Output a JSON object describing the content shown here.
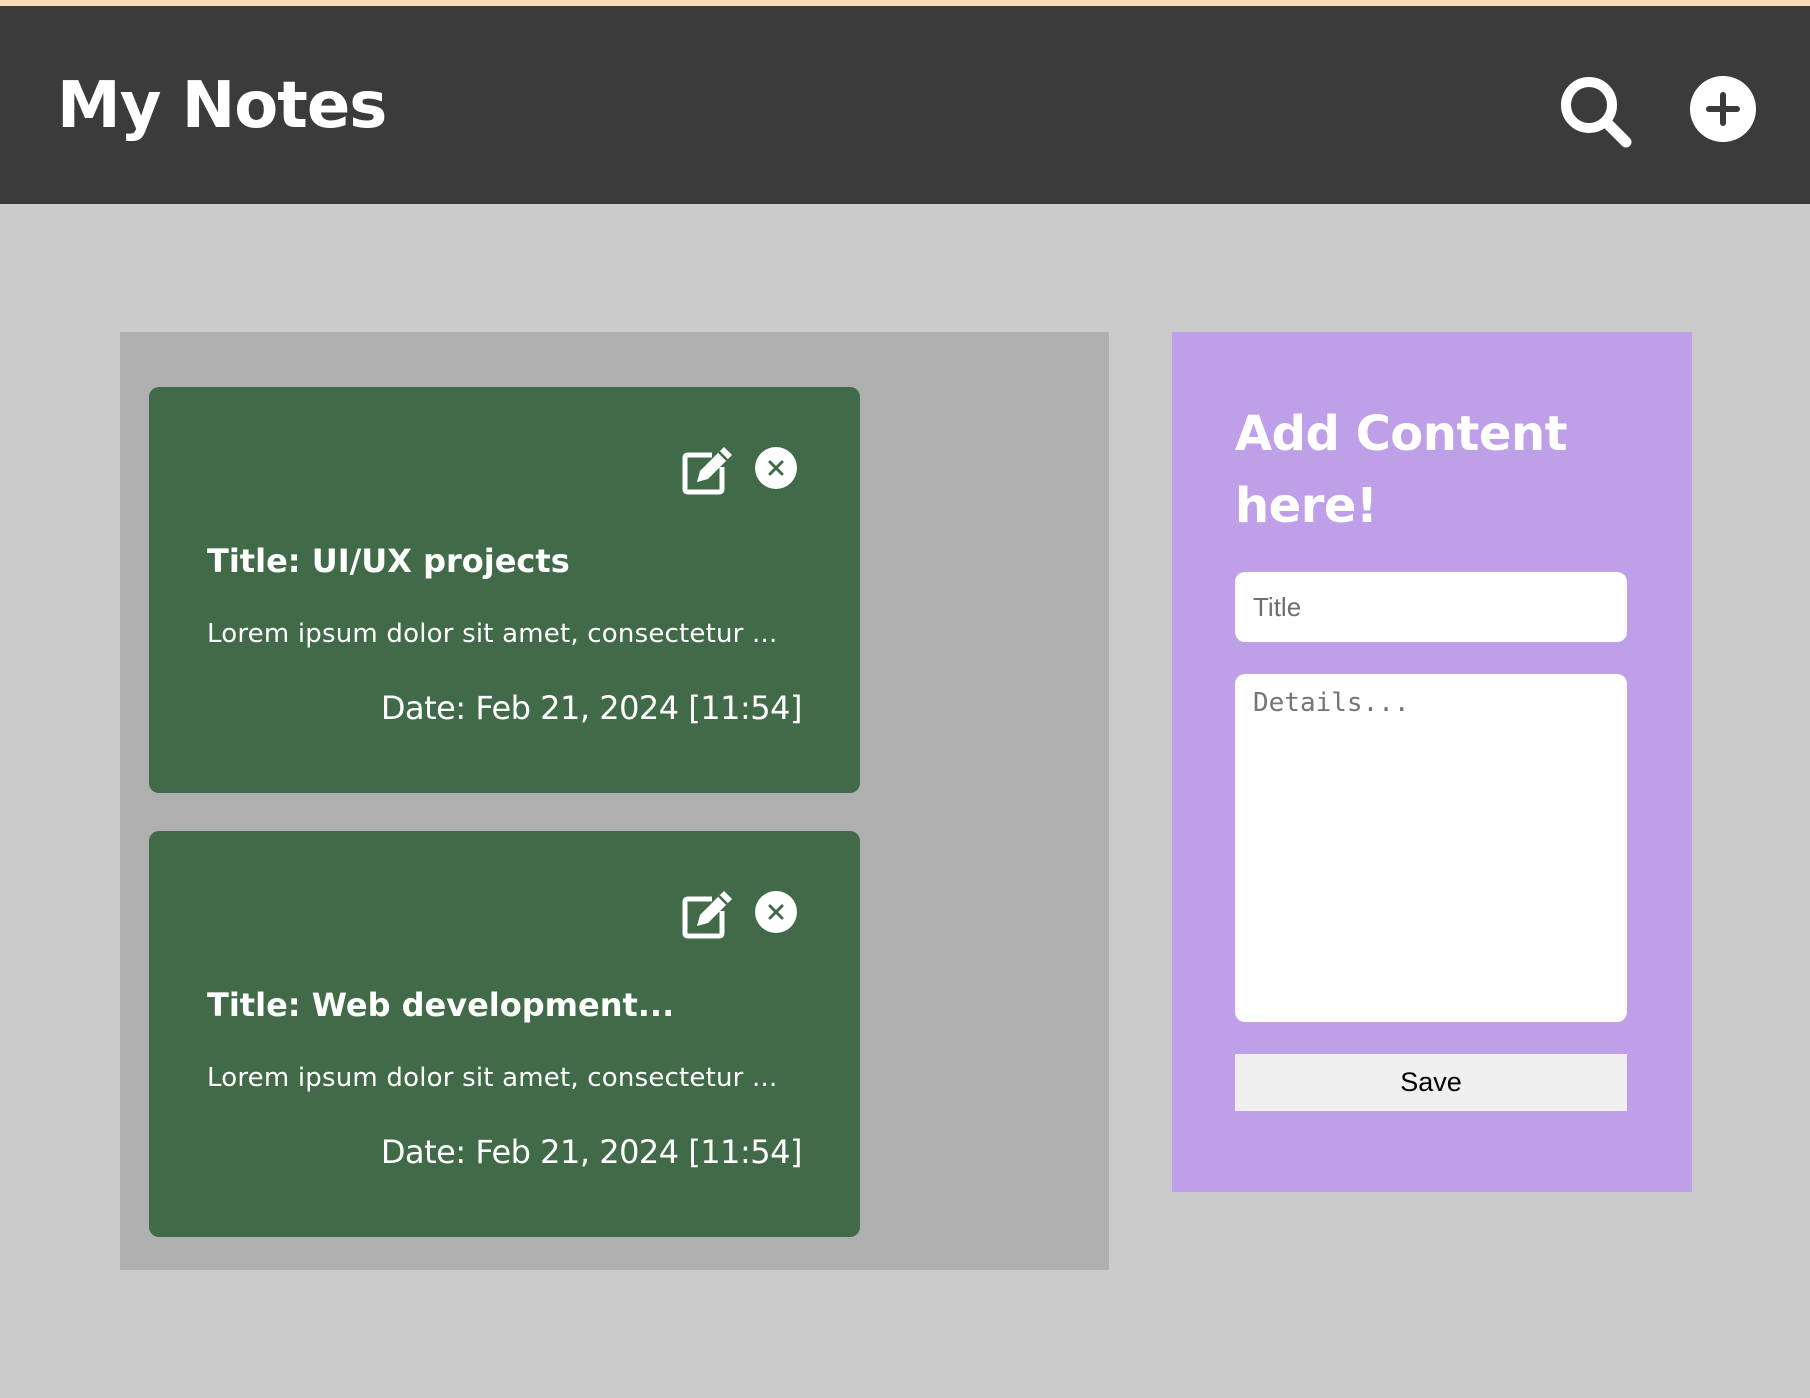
{
  "header": {
    "title": "My Notes",
    "search_icon": "search-icon",
    "add_icon": "plus-circle-icon"
  },
  "notes": [
    {
      "title": "Title: UI/UX projects",
      "body": "Lorem ipsum dolor sit amet, consectetur ...",
      "date": "Date: Feb 21, 2024 [11:54]",
      "edit_icon": "edit-icon",
      "delete_icon": "close-circle-icon"
    },
    {
      "title": "Title: Web development...",
      "body": "Lorem ipsum dolor sit amet, consectetur ...",
      "date": "Date: Feb 21, 2024 [11:54]",
      "edit_icon": "edit-icon",
      "delete_icon": "close-circle-icon"
    }
  ],
  "form": {
    "heading": "Add Content here!",
    "title_placeholder": "Title",
    "details_placeholder": "Details...",
    "save_label": "Save"
  },
  "colors": {
    "header_bg": "#3b3b3b",
    "page_bg": "#cbcbcb",
    "notes_panel_bg": "#afafaf",
    "note_card_bg": "#416a49",
    "form_panel_bg": "#bf9fe8",
    "top_strip": "#f7dcb4"
  }
}
